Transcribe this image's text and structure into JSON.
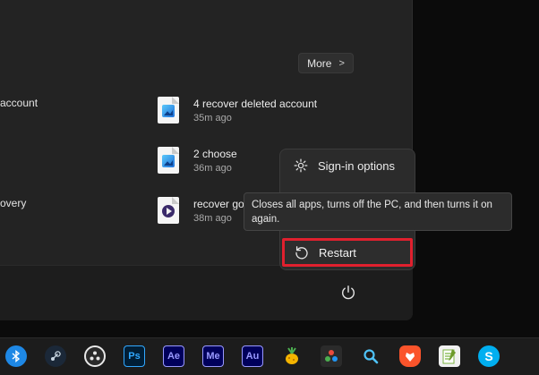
{
  "start_menu": {
    "more_label": "More",
    "more_chevron": ">",
    "left_fragments": [
      "account",
      "overy"
    ],
    "recommended": [
      {
        "name": "4 recover deleted account",
        "time": "35m ago",
        "icon": "image-file-icon"
      },
      {
        "name": "2 choose",
        "time": "36m ago",
        "icon": "image-file-icon"
      },
      {
        "name": "recover go",
        "time": "38m ago",
        "icon": "video-file-icon"
      }
    ]
  },
  "power_menu": {
    "sign_in_options": "Sign-in options",
    "restart": "Restart",
    "tooltip": "Closes all apps, turns off the PC, and then turns it on again."
  },
  "taskbar": {
    "apps": [
      {
        "name": "bluetooth-app-icon",
        "label": "",
        "color": "#1e88e5"
      },
      {
        "name": "steam-icon",
        "label": "",
        "color": "#1b2838"
      },
      {
        "name": "obs-icon",
        "label": "",
        "color": "#2a2a2a"
      },
      {
        "name": "photoshop-icon",
        "label": "Ps",
        "color": "#001e36",
        "fg": "#31a8ff"
      },
      {
        "name": "after-effects-icon",
        "label": "Ae",
        "color": "#00005b",
        "fg": "#9999ff"
      },
      {
        "name": "media-encoder-icon",
        "label": "Me",
        "color": "#00005b",
        "fg": "#9999ff"
      },
      {
        "name": "audition-icon",
        "label": "Au",
        "color": "#00005b",
        "fg": "#9999ff"
      },
      {
        "name": "fruit-app-icon",
        "label": "",
        "color": "#3a3a3a"
      },
      {
        "name": "davinci-resolve-icon",
        "label": "",
        "color": "#2b2b2b"
      },
      {
        "name": "search-icon",
        "label": "",
        "color": "transparent"
      },
      {
        "name": "brave-icon",
        "label": "",
        "color": "#fb542b"
      },
      {
        "name": "notepad-icon",
        "label": "",
        "color": "#7cb342"
      },
      {
        "name": "skype-icon",
        "label": "S",
        "color": "#00aff0",
        "fg": "#ffffff"
      }
    ]
  }
}
